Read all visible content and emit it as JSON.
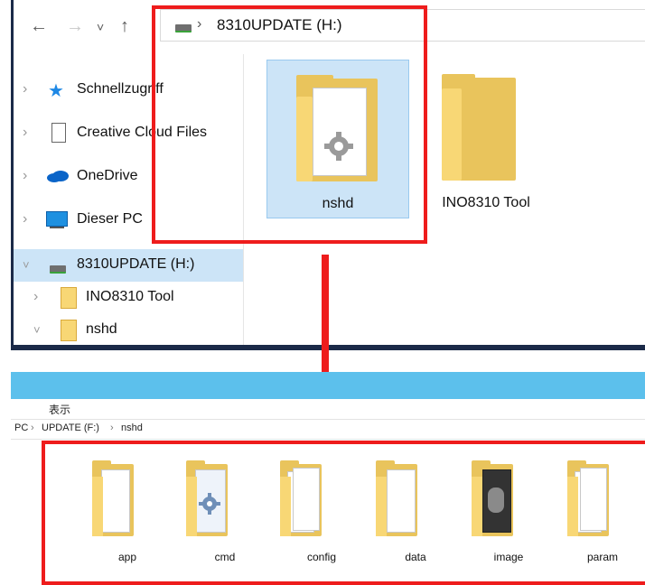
{
  "top_window": {
    "address": {
      "separator": "›",
      "path": "8310UPDATE (H:)"
    },
    "nav": {
      "back": "←",
      "forward": "→",
      "recent": "˅",
      "up": "↑"
    },
    "tree": [
      {
        "label": "Schnellzugriff",
        "icon": "star-icon",
        "chevron": "›"
      },
      {
        "label": "Creative Cloud Files",
        "icon": "document-icon",
        "chevron": "›"
      },
      {
        "label": "OneDrive",
        "icon": "cloud-icon",
        "chevron": "›"
      },
      {
        "label": "Dieser PC",
        "icon": "monitor-icon",
        "chevron": "›"
      },
      {
        "label": "8310UPDATE (H:)",
        "icon": "drive-icon",
        "chevron": "˅"
      },
      {
        "label": "INO8310 Tool",
        "icon": "folder-icon",
        "chevron": "›"
      },
      {
        "label": "nshd",
        "icon": "folder-icon",
        "chevron": "˅"
      }
    ],
    "items": [
      {
        "label": "nshd",
        "icon": "folder-with-gear-icon"
      },
      {
        "label": "INO8310 Tool",
        "icon": "folder-icon"
      }
    ]
  },
  "bottom_window": {
    "menu_label": "表示",
    "breadcrumb": {
      "part1": "PC",
      "sep": "›",
      "part2": "UPDATE (F:)",
      "part3": "nshd"
    },
    "items": [
      {
        "label": "app"
      },
      {
        "label": "cmd"
      },
      {
        "label": "config"
      },
      {
        "label": "data"
      },
      {
        "label": "image"
      },
      {
        "label": "param"
      }
    ]
  },
  "colors": {
    "highlight": "#ee1c1c",
    "selection": "#cce4f7",
    "ribbon": "#5cc0ec",
    "folder": "#f8d775"
  }
}
